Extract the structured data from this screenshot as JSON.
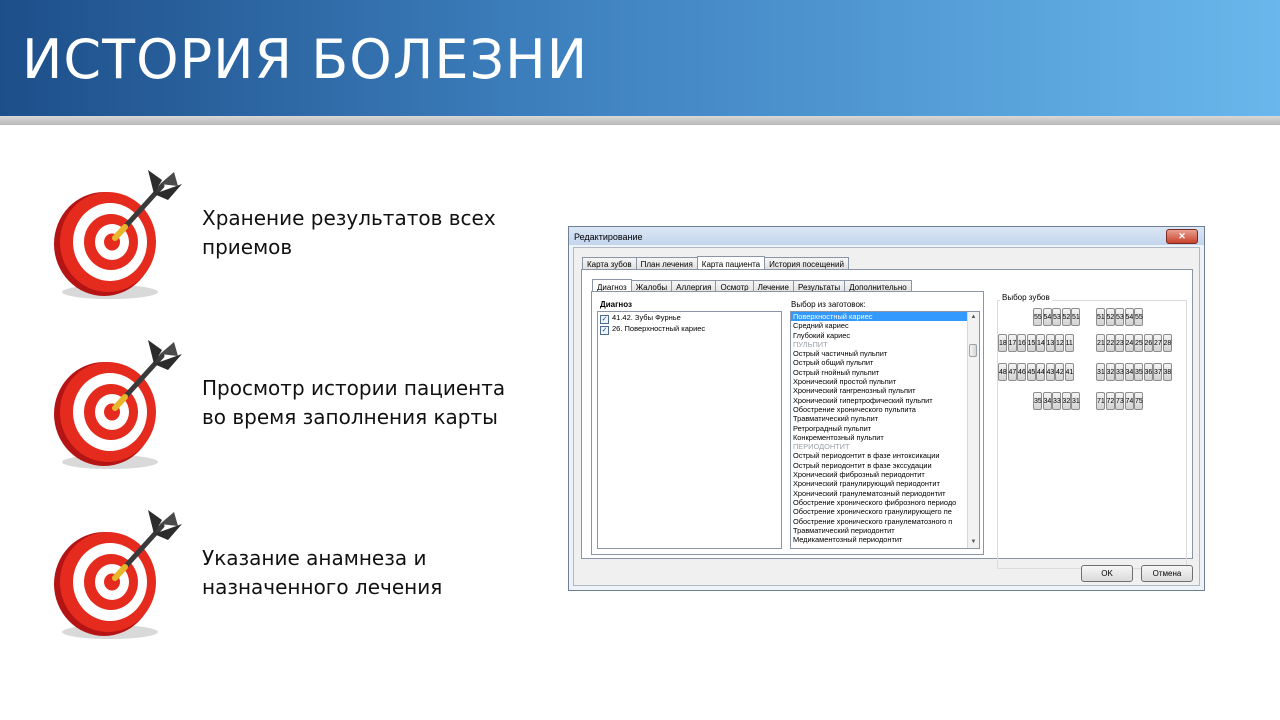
{
  "slide": {
    "title": "ИСТОРИЯ БОЛЕЗНИ",
    "features": [
      {
        "line1": "Хранение результатов всех",
        "line2": "приемов"
      },
      {
        "line1": "Просмотр истории пациента",
        "line2": "во время заполнения карты"
      },
      {
        "line1": "Указание анамнеза и",
        "line2": "назначенного лечения"
      }
    ]
  },
  "dialog": {
    "title": "Редактирование",
    "close_label": "✕",
    "tabs": [
      "Карта зубов",
      "План лечения",
      "Карта пациента",
      "История посещений"
    ],
    "active_tab": 2,
    "subtabs": [
      "Диагноз",
      "Жалобы",
      "Аллергия",
      "Осмотр",
      "Лечение",
      "Результаты",
      "Дополнительно"
    ],
    "active_subtab": 0,
    "diagnosis": {
      "label": "Диагноз",
      "items": [
        {
          "text": "41.42. Зубы Фурнье",
          "checked": true
        },
        {
          "text": "26. Поверхностный кариес",
          "checked": true
        }
      ]
    },
    "presets": {
      "label": "Выбор из заготовок:",
      "items": [
        {
          "text": "Поверхностный кариес",
          "kind": "selected"
        },
        {
          "text": "Средний кариес",
          "kind": "item"
        },
        {
          "text": "Глубокий кариес",
          "kind": "item"
        },
        {
          "text": "ПУЛЬПИТ",
          "kind": "category"
        },
        {
          "text": "Острый частичный пульпит",
          "kind": "item"
        },
        {
          "text": "Острый общий пульпит",
          "kind": "item"
        },
        {
          "text": "Острый гнойный пульпит",
          "kind": "item"
        },
        {
          "text": "Хронический простой пульпит",
          "kind": "item"
        },
        {
          "text": "Хронический гангренозный пульпит",
          "kind": "item"
        },
        {
          "text": "Хронический гипертрофический пульпит",
          "kind": "item"
        },
        {
          "text": "Обострение хронического пульпита",
          "kind": "item"
        },
        {
          "text": "Травматический пульпит",
          "kind": "item"
        },
        {
          "text": "Ретроградный пульпит",
          "kind": "item"
        },
        {
          "text": "Конкрементозный пульпит",
          "kind": "item"
        },
        {
          "text": "ПЕРИОДОНТИТ",
          "kind": "category"
        },
        {
          "text": "Острый периодонтит в фазе интоксикации",
          "kind": "item"
        },
        {
          "text": "Острый периодонтит  в фазе экссудации",
          "kind": "item"
        },
        {
          "text": "Хронический фиброзный периодонтит",
          "kind": "item"
        },
        {
          "text": "Хронический гранулирующий периодонтит",
          "kind": "item"
        },
        {
          "text": "Хронический гранулематозный периодонтит",
          "kind": "item"
        },
        {
          "text": "Обострение хронического фиброзного периодо",
          "kind": "item"
        },
        {
          "text": "Обострение хронического гранулирующего пе",
          "kind": "item"
        },
        {
          "text": "Обострение хронического гранулематозного п",
          "kind": "item"
        },
        {
          "text": "Травматический периодонтит",
          "kind": "item"
        },
        {
          "text": "Медикаментозный периодонтит",
          "kind": "item"
        }
      ]
    },
    "teeth": {
      "label": "Выбор зубов",
      "rows": [
        {
          "left": [
            "55",
            "54",
            "53",
            "52",
            "51"
          ],
          "right": [
            "51",
            "52",
            "53",
            "54",
            "55"
          ]
        },
        {
          "left": [
            "18",
            "17",
            "16",
            "15",
            "14",
            "13",
            "12",
            "11"
          ],
          "right": [
            "21",
            "22",
            "23",
            "24",
            "25",
            "26",
            "27",
            "28"
          ]
        },
        {
          "left": [
            "48",
            "47",
            "46",
            "45",
            "44",
            "43",
            "42",
            "41"
          ],
          "right": [
            "31",
            "32",
            "33",
            "34",
            "35",
            "36",
            "37",
            "38"
          ]
        },
        {
          "left": [
            "35",
            "34",
            "33",
            "32",
            "31"
          ],
          "right": [
            "71",
            "72",
            "73",
            "74",
            "75"
          ]
        }
      ]
    },
    "ok_label": "OK",
    "cancel_label": "Отмена"
  }
}
